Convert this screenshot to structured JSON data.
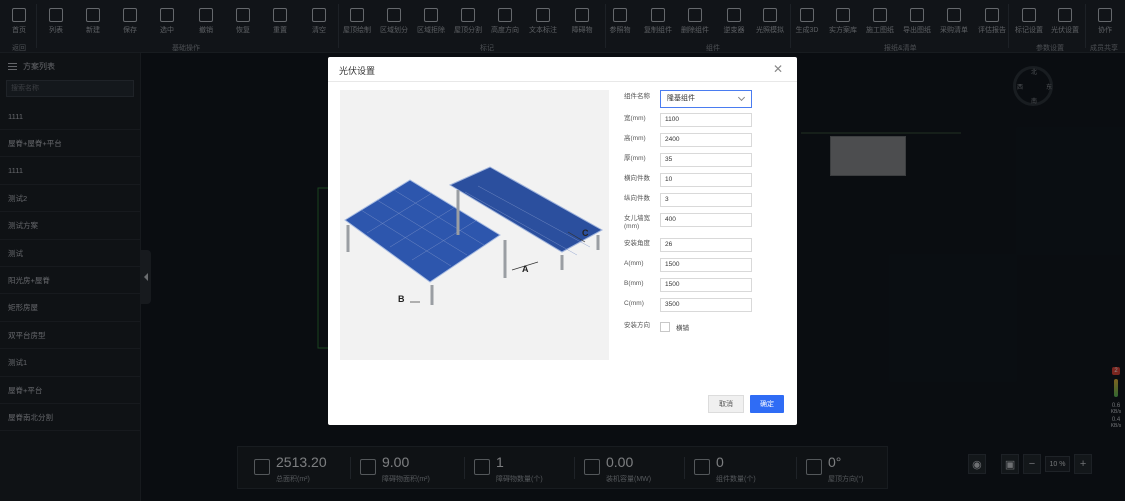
{
  "toolbar": {
    "items": [
      {
        "label": "首页",
        "icon": "home-icon"
      },
      {
        "label": "列表",
        "icon": "list-icon"
      },
      {
        "label": "新建",
        "icon": "new-file-icon"
      },
      {
        "label": "保存",
        "icon": "save-icon"
      },
      {
        "label": "选中",
        "icon": "select-icon"
      },
      {
        "label": "撤销",
        "icon": "undo-icon"
      },
      {
        "label": "恢复",
        "icon": "redo-icon"
      },
      {
        "label": "重置",
        "icon": "reset-icon"
      },
      {
        "label": "清空",
        "icon": "trash-icon"
      },
      {
        "label": "屋顶绘制",
        "icon": "roof-draw-icon"
      },
      {
        "label": "区域划分",
        "icon": "region-divide-icon"
      },
      {
        "label": "区域拒除",
        "icon": "region-remove-icon"
      },
      {
        "label": "屋顶分割",
        "icon": "roof-split-icon"
      },
      {
        "label": "高度方向",
        "icon": "height-direction-icon"
      },
      {
        "label": "文本标注",
        "icon": "text-annotation-icon"
      },
      {
        "label": "障碍物",
        "icon": "obstacle-icon"
      },
      {
        "label": "参照物",
        "icon": "reference-icon"
      },
      {
        "label": "复制组件",
        "icon": "copy-component-icon"
      },
      {
        "label": "删除组件",
        "icon": "delete-component-icon"
      },
      {
        "label": "逆变器",
        "icon": "inverter-icon"
      },
      {
        "label": "光照模拟",
        "icon": "sun-simulation-icon"
      },
      {
        "label": "生成3D",
        "icon": "generate-3d-icon"
      },
      {
        "label": "实方案库",
        "icon": "plan-library-icon"
      },
      {
        "label": "施工图纸",
        "icon": "construction-drawing-icon"
      },
      {
        "label": "导出图纸",
        "icon": "export-drawing-icon"
      },
      {
        "label": "采购清单",
        "icon": "purchase-list-icon"
      },
      {
        "label": "评估报告",
        "icon": "report-icon"
      },
      {
        "label": "标记设置",
        "icon": "mark-settings-icon"
      },
      {
        "label": "光伏设置",
        "icon": "pv-settings-icon"
      },
      {
        "label": "协作",
        "icon": "user-icon"
      }
    ],
    "groups": [
      "返回",
      "基础操作",
      "标记",
      "组件",
      "报纸&清单",
      "参数设置",
      "成员共享"
    ]
  },
  "sidebar": {
    "title": "方案列表",
    "search_placeholder": "搜索名称",
    "items": [
      "1111",
      "屋脊+屋脊+平台",
      "1111",
      "测试2",
      "测试方案",
      "测试",
      "阳光房+屋脊",
      "矩形房屋",
      "双平台房型",
      "测试1",
      "屋脊+平台",
      "屋脊南北分割"
    ]
  },
  "canvas": {
    "compass": {
      "north": "北",
      "east": "东",
      "south": "南",
      "west": "西"
    },
    "meter": {
      "badge": "2",
      "v1": "0.6",
      "u1": "KB/s",
      "v2": "0.4",
      "u2": "KB/s"
    }
  },
  "bottom": {
    "stats": [
      {
        "value": "2513.20",
        "label": "总面积(m²)",
        "icon": "area-icon"
      },
      {
        "value": "9.00",
        "label": "障碍物面积(m²)",
        "icon": "obstacle-area-icon"
      },
      {
        "value": "1",
        "label": "障碍物数量(个)",
        "icon": "cone-icon"
      },
      {
        "value": "0.00",
        "label": "装机容量(MW)",
        "icon": "battery-icon"
      },
      {
        "value": "0",
        "label": "组件数量(个)",
        "icon": "grid-icon"
      },
      {
        "value": "0°",
        "label": "屋顶方向(°)",
        "icon": "direction-icon"
      }
    ],
    "zoom": {
      "value": "10",
      "unit": "%",
      "minus": "−",
      "plus": "+"
    }
  },
  "modal": {
    "title": "光伏设置",
    "fields": [
      {
        "label": "组件名称",
        "value": "隆基组件",
        "type": "select"
      },
      {
        "label": "宽(mm)",
        "value": "1100"
      },
      {
        "label": "高(mm)",
        "value": "2400"
      },
      {
        "label": "厚(mm)",
        "value": "35"
      },
      {
        "label": "横向件数",
        "value": "10"
      },
      {
        "label": "纵向件数",
        "value": "3"
      },
      {
        "label": "女儿墙宽(mm)",
        "value": "400"
      },
      {
        "label": "安装角度",
        "value": "26"
      },
      {
        "label": "A(mm)",
        "value": "1500"
      },
      {
        "label": "B(mm)",
        "value": "1500"
      },
      {
        "label": "C(mm)",
        "value": "3500"
      }
    ],
    "mount": {
      "label": "安装方向",
      "option": "横铺"
    },
    "image_labels": {
      "a": "A",
      "b": "B",
      "c": "C"
    },
    "cancel": "取消",
    "ok": "确定"
  }
}
